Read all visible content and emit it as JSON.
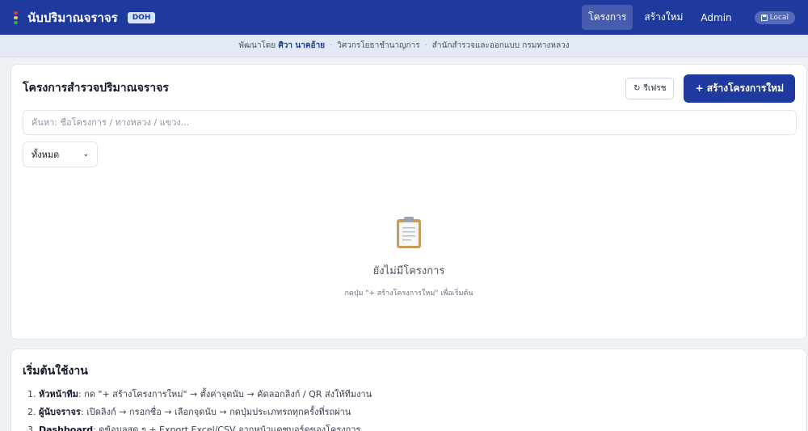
{
  "header": {
    "title": "นับปริมาณจราจร",
    "badge": "DOH",
    "nav": [
      {
        "label": "โครงการ",
        "active": true
      },
      {
        "label": "สร้างใหม่",
        "active": false
      },
      {
        "label": "Admin",
        "active": false
      }
    ],
    "sync_label": "Local",
    "accent": "#1e3a9e"
  },
  "credits": {
    "prefix": "พัฒนาโดย",
    "author": "ศิวา นาคอ้าย",
    "role": "วิศวกรโยธาชำนาญการ",
    "org": "สำนักสำรวจและออกแบบ กรมทางหลวง",
    "separator": "·"
  },
  "projects": {
    "title": "โครงการสำรวจปริมาณจราจร",
    "refresh_label": "รีเฟรช",
    "create_label": "+ สร้างโครงการใหม่",
    "search_placeholder": "ค้นหา: ชื่อโครงการ / ทางหลวง / แขวง...",
    "filter_value": "ทั้งหมด",
    "empty_title": "ยังไม่มีโครงการ",
    "empty_hint": "กดปุ่ม \"+ สร้างโครงการใหม่\" เพื่อเริ่มต้น"
  },
  "getting_started": {
    "title": "เริ่มต้นใช้งาน",
    "steps": [
      {
        "num": "1.",
        "bold": "หัวหน้าทีม",
        "text": ": กด \"+ สร้างโครงการใหม่\" → ตั้งค่าจุดนับ → คัดลอกลิงก์ / QR ส่งให้ทีมงาน"
      },
      {
        "num": "2.",
        "bold": "ผู้นับจราจร",
        "text": ": เปิดลิงก์ → กรอกชื่อ → เลือกจุดนับ → กดปุ่มประเภทรถทุกครั้งที่รถผ่าน"
      },
      {
        "num": "3.",
        "bold": "Dashboard",
        "text": ": ดูข้อมูลสด ๆ + Export Excel/CSV จากหน้าแดชบอร์ดของโครงการ"
      }
    ]
  }
}
